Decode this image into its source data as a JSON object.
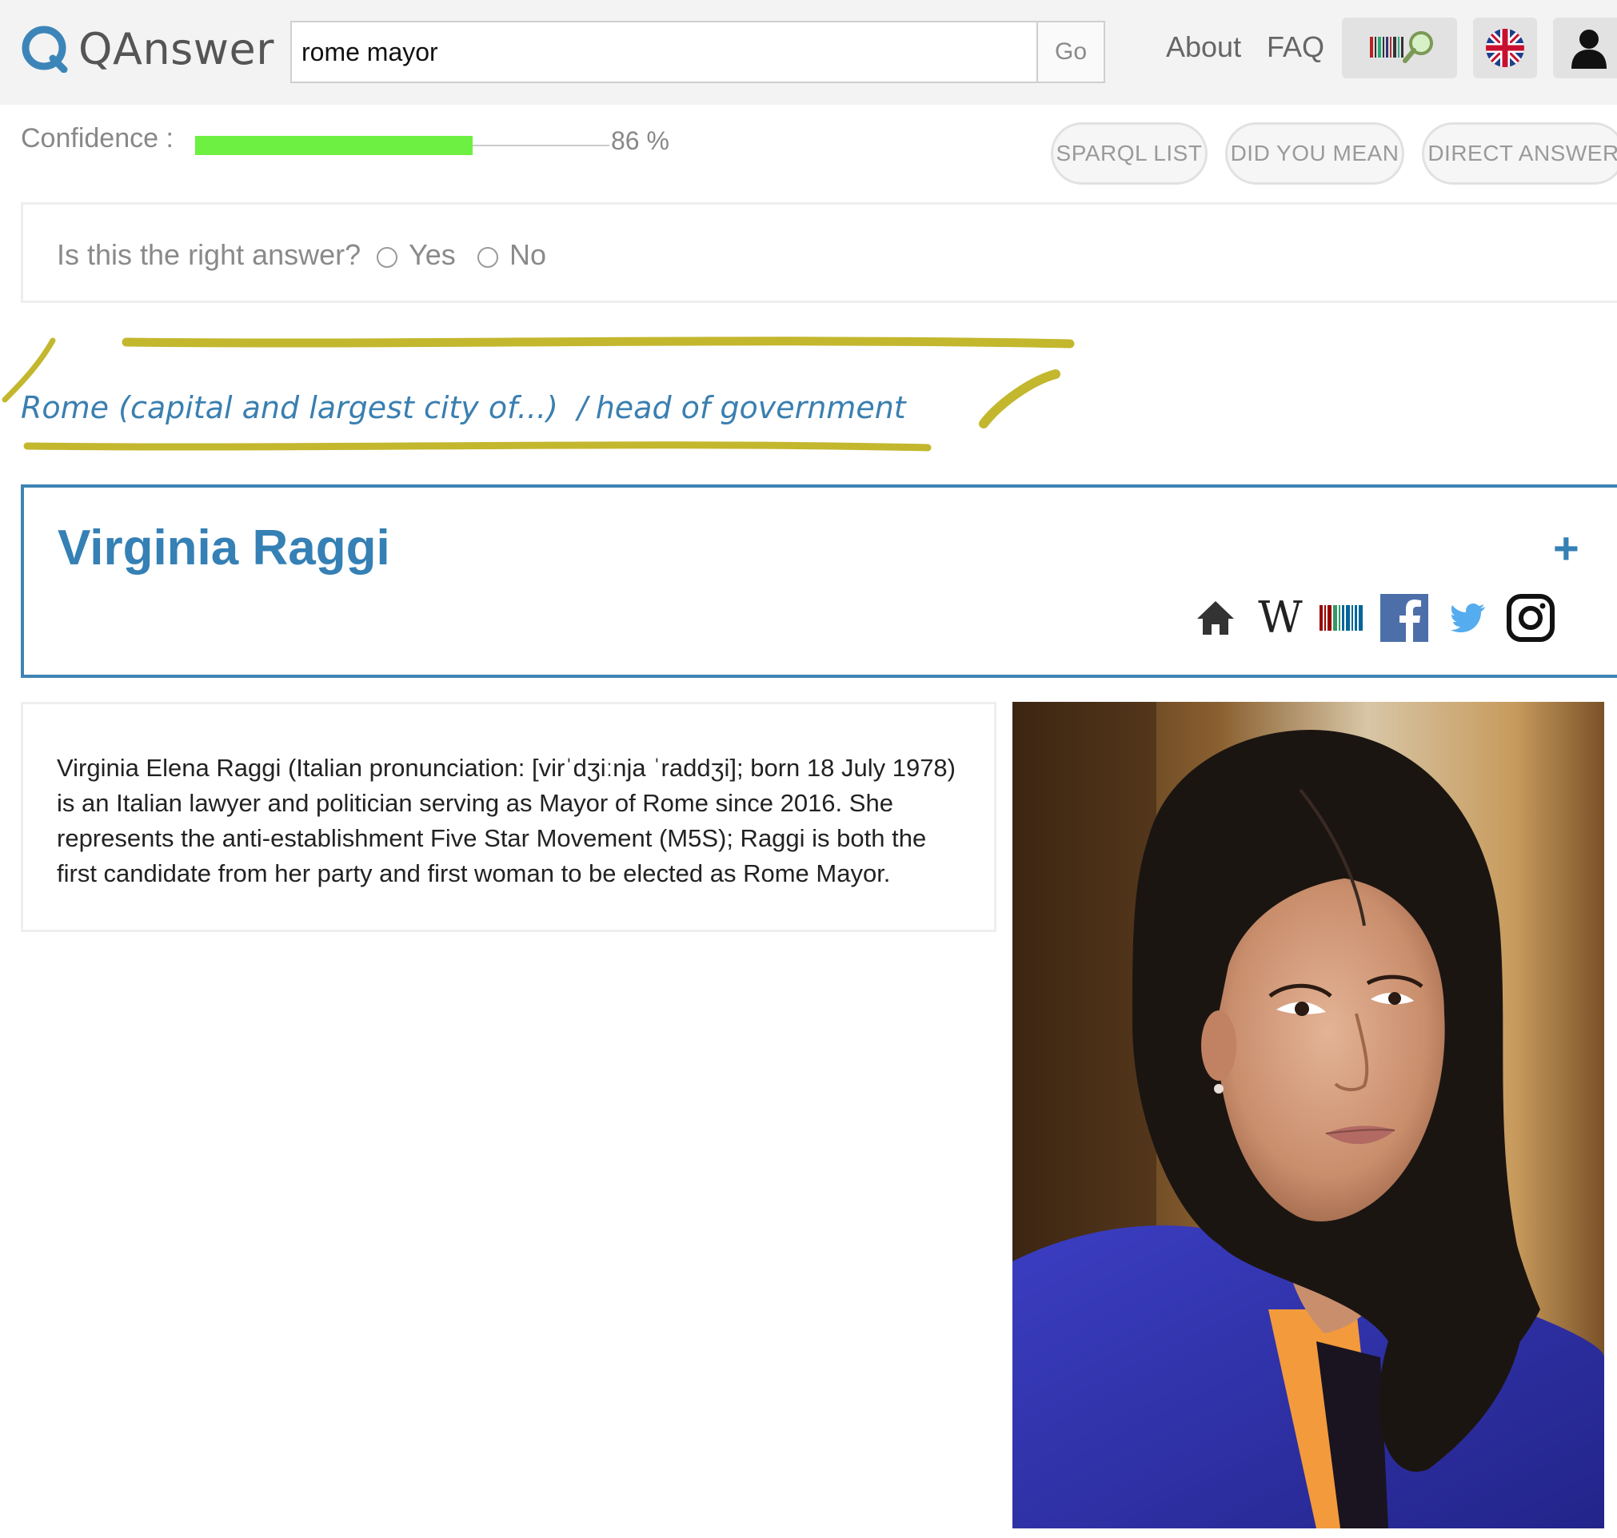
{
  "app": {
    "logo_text": "QAnswer"
  },
  "search": {
    "value": "rome mayor",
    "go_label": "Go"
  },
  "nav": {
    "about": "About",
    "faq": "FAQ"
  },
  "icons": {
    "barcode_search": "barcode-search-icon",
    "language": "uk-flag-icon",
    "user": "user-icon"
  },
  "confidence": {
    "label": "Confidence :",
    "value": 86,
    "value_text": "86 %",
    "bar_color": "#6ef043"
  },
  "buttons": {
    "sparql_list": "SPARQL LIST",
    "did_you_mean": "DID YOU MEAN",
    "direct_answer": "DIRECT ANSWER"
  },
  "feedback": {
    "question": "Is this the right answer?",
    "yes": "Yes",
    "no": "No"
  },
  "breadcrumb": {
    "entity": "Rome (capital and largest city of...)",
    "separator": "/",
    "property": "head of government"
  },
  "answer": {
    "title": "Virginia Raggi",
    "expand": "+",
    "links": [
      "home-icon",
      "wikipedia-icon",
      "wikidata-icon",
      "facebook-icon",
      "twitter-icon",
      "instagram-icon"
    ],
    "wikipedia_glyph": "W",
    "description": "Virginia Elena Raggi (Italian pronunciation: [virˈdʒiːnja ˈraddʒi]; born 18 July 1978) is an Italian lawyer and politician serving as Mayor of Rome since 2016. She represents the anti-establishment Five Star Movement (M5S); Raggi is both the first candidate from her party and first woman to be elected as Rome Mayor."
  },
  "colors": {
    "accent": "#3580b5",
    "highlight": "#c3b72e",
    "facebook": "#4d6fa9",
    "twitter": "#55acee"
  }
}
